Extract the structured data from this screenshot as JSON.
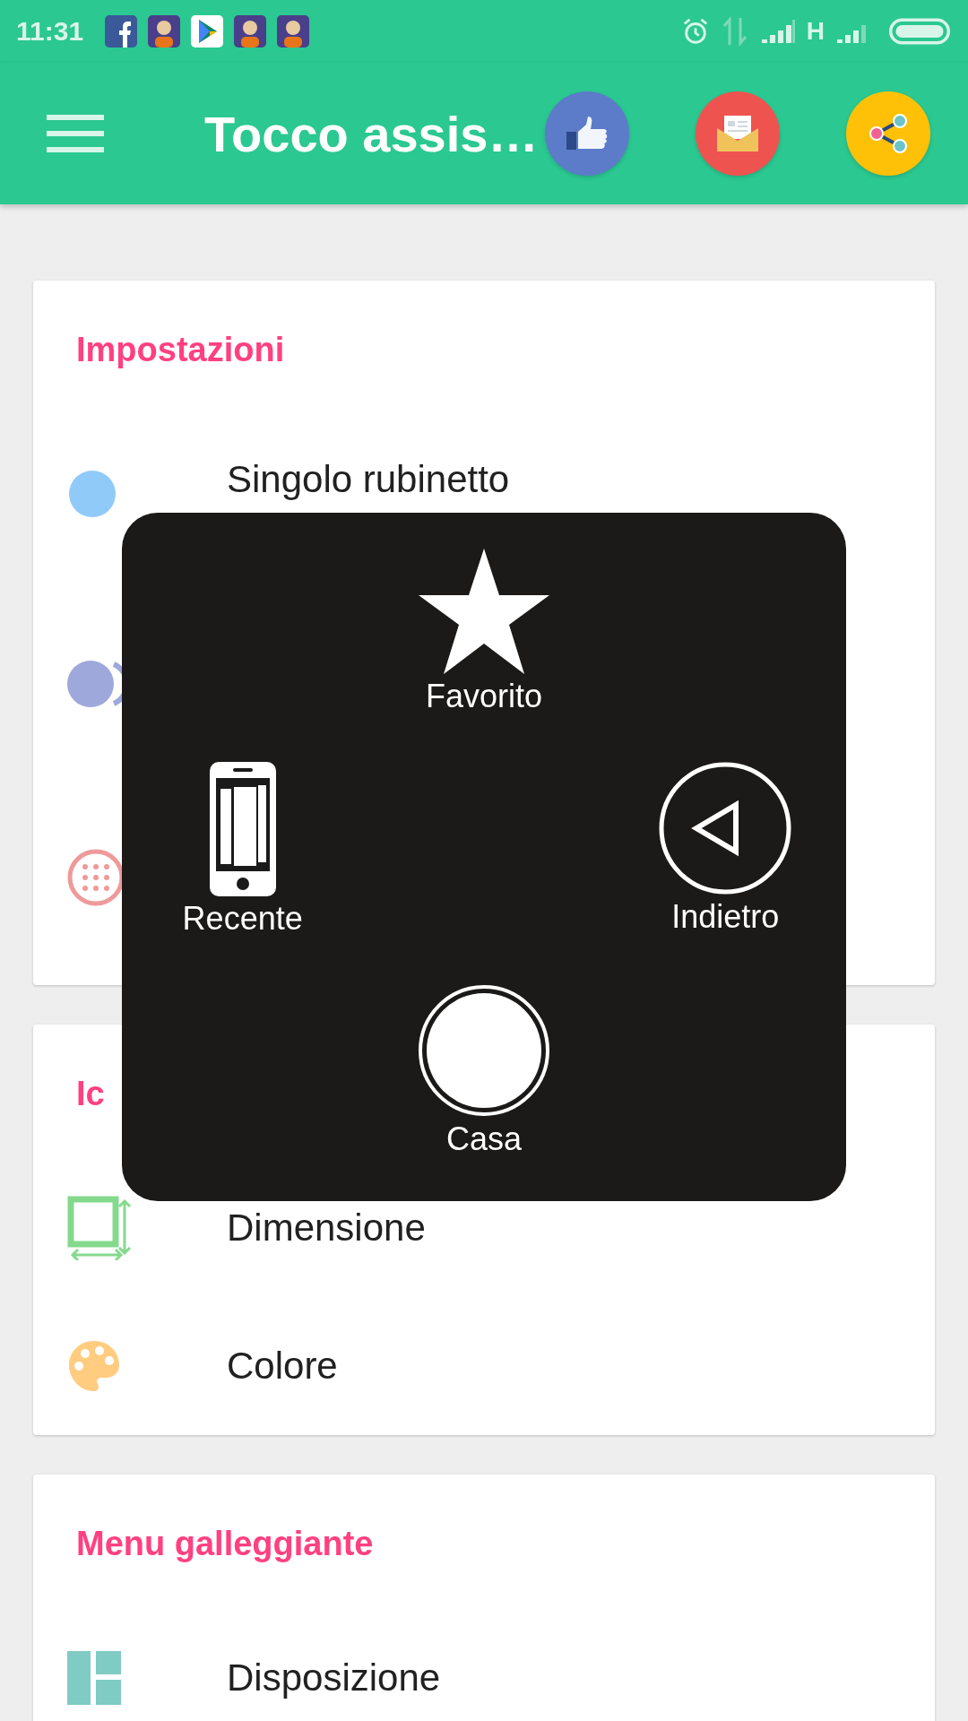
{
  "status_bar": {
    "time": "11:31",
    "network": "H"
  },
  "app_bar": {
    "title": "Tocco assis…"
  },
  "sections": [
    {
      "title": "Impostazioni",
      "items": [
        {
          "kind": "dot",
          "title": "Singolo rubinetto"
        },
        {
          "kind": "double-dot"
        },
        {
          "kind": "dotted-circle"
        }
      ]
    },
    {
      "title": "Ic",
      "items": [
        {
          "kind": "resize",
          "title": "Dimensione"
        },
        {
          "kind": "palette",
          "title": "Colore"
        }
      ]
    },
    {
      "title": "Menu galleggiante",
      "items": [
        {
          "kind": "layout",
          "title": "Disposizione"
        }
      ]
    }
  ],
  "assistive_menu": {
    "items": [
      {
        "kind": "star",
        "label": "Favorito"
      },
      {
        "kind": "phone",
        "label": "Recente"
      },
      {
        "kind": "back",
        "label": "Indietro"
      },
      {
        "kind": "home",
        "label": "Casa"
      }
    ]
  }
}
